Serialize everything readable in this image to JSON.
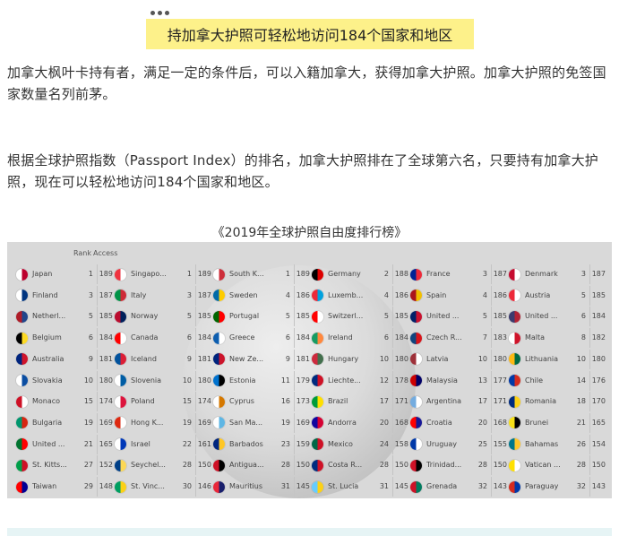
{
  "header": {
    "title": "持加拿大护照可轻松地访问184个国家和地区"
  },
  "paragraphs": [
    "加拿大枫叶卡持有者，满足一定的条件后，可以入籍加拿大，获得加拿大护照。加拿大护照的免签国家数量名列前茅。",
    "根据全球护照指数（Passport Index）的排名，加拿大护照排在了全球第六名，只要持有加拿大护照，现在可以轻松地访问184个国家和地区。"
  ],
  "caption": "《2019年全球护照自由度排行榜》",
  "table": {
    "rank_header": "Rank",
    "access_header": "Access",
    "columns": [
      [
        {
          "name": "Japan",
          "rank": "1",
          "access": "189",
          "colors": [
            "#ffffff",
            "#bc002d"
          ]
        },
        {
          "name": "Finland",
          "rank": "3",
          "access": "187",
          "colors": [
            "#ffffff",
            "#003580"
          ]
        },
        {
          "name": "Netherl...",
          "rank": "5",
          "access": "185",
          "colors": [
            "#ae1c28",
            "#21468b"
          ]
        },
        {
          "name": "Belgium",
          "rank": "6",
          "access": "184",
          "colors": [
            "#000000",
            "#fdda24"
          ]
        },
        {
          "name": "Australia",
          "rank": "9",
          "access": "181",
          "colors": [
            "#00247d",
            "#cf142b"
          ]
        },
        {
          "name": "Slovakia",
          "rank": "10",
          "access": "180",
          "colors": [
            "#ffffff",
            "#0b4ea2"
          ]
        },
        {
          "name": "Monaco",
          "rank": "15",
          "access": "174",
          "colors": [
            "#ce1126",
            "#ffffff"
          ]
        },
        {
          "name": "Bulgaria",
          "rank": "19",
          "access": "169",
          "colors": [
            "#00966e",
            "#d62612"
          ]
        },
        {
          "name": "United ...",
          "rank": "21",
          "access": "165",
          "colors": [
            "#00732f",
            "#ff0000"
          ]
        },
        {
          "name": "St. Kitts...",
          "rank": "27",
          "access": "152",
          "colors": [
            "#009e49",
            "#ce1126"
          ]
        },
        {
          "name": "Taiwan",
          "rank": "29",
          "access": "148",
          "colors": [
            "#fe0000",
            "#000095"
          ]
        }
      ],
      [
        {
          "name": "Singapo...",
          "rank": "1",
          "access": "189",
          "colors": [
            "#ef3340",
            "#ffffff"
          ]
        },
        {
          "name": "Italy",
          "rank": "3",
          "access": "187",
          "colors": [
            "#009246",
            "#ce2b37"
          ]
        },
        {
          "name": "Norway",
          "rank": "5",
          "access": "185",
          "colors": [
            "#ba0c2f",
            "#00205b"
          ]
        },
        {
          "name": "Canada",
          "rank": "6",
          "access": "184",
          "colors": [
            "#ff0000",
            "#ffffff"
          ]
        },
        {
          "name": "Iceland",
          "rank": "9",
          "access": "181",
          "colors": [
            "#02529c",
            "#dc1e35"
          ]
        },
        {
          "name": "Slovenia",
          "rank": "10",
          "access": "180",
          "colors": [
            "#ffffff",
            "#005da4"
          ]
        },
        {
          "name": "Poland",
          "rank": "15",
          "access": "174",
          "colors": [
            "#ffffff",
            "#dc143c"
          ]
        },
        {
          "name": "Hong K...",
          "rank": "19",
          "access": "169",
          "colors": [
            "#de2910",
            "#ffffff"
          ]
        },
        {
          "name": "Israel",
          "rank": "22",
          "access": "161",
          "colors": [
            "#ffffff",
            "#0038b8"
          ]
        },
        {
          "name": "Seychel...",
          "rank": "28",
          "access": "150",
          "colors": [
            "#003f87",
            "#fcd856"
          ]
        },
        {
          "name": "St. Vinc...",
          "rank": "30",
          "access": "146",
          "colors": [
            "#009e60",
            "#fcd116"
          ]
        }
      ],
      [
        {
          "name": "South K...",
          "rank": "1",
          "access": "189",
          "colors": [
            "#ffffff",
            "#cd2e3a"
          ]
        },
        {
          "name": "Sweden",
          "rank": "4",
          "access": "186",
          "colors": [
            "#006aa7",
            "#fecc00"
          ]
        },
        {
          "name": "Portugal",
          "rank": "5",
          "access": "185",
          "colors": [
            "#006600",
            "#ff0000"
          ]
        },
        {
          "name": "Greece",
          "rank": "6",
          "access": "184",
          "colors": [
            "#0d5eaf",
            "#ffffff"
          ]
        },
        {
          "name": "New Ze...",
          "rank": "9",
          "access": "181",
          "colors": [
            "#00247d",
            "#cc142b"
          ]
        },
        {
          "name": "Estonia",
          "rank": "11",
          "access": "179",
          "colors": [
            "#0072ce",
            "#000000"
          ]
        },
        {
          "name": "Cyprus",
          "rank": "16",
          "access": "173",
          "colors": [
            "#ffffff",
            "#d57800"
          ]
        },
        {
          "name": "San Ma...",
          "rank": "19",
          "access": "169",
          "colors": [
            "#ffffff",
            "#5eb6e4"
          ]
        },
        {
          "name": "Barbados",
          "rank": "23",
          "access": "159",
          "colors": [
            "#00267f",
            "#ffc726"
          ]
        },
        {
          "name": "Antigua...",
          "rank": "28",
          "access": "150",
          "colors": [
            "#ce1126",
            "#000000"
          ]
        },
        {
          "name": "Mauritius",
          "rank": "31",
          "access": "145",
          "colors": [
            "#ea2839",
            "#1a206d"
          ]
        }
      ],
      [
        {
          "name": "Germany",
          "rank": "2",
          "access": "188",
          "colors": [
            "#000000",
            "#dd0000"
          ]
        },
        {
          "name": "Luxemb...",
          "rank": "4",
          "access": "186",
          "colors": [
            "#ed2939",
            "#00a1de"
          ]
        },
        {
          "name": "Switzerl...",
          "rank": "5",
          "access": "185",
          "colors": [
            "#ff0000",
            "#ffffff"
          ]
        },
        {
          "name": "Ireland",
          "rank": "6",
          "access": "184",
          "colors": [
            "#169b62",
            "#ff883e"
          ]
        },
        {
          "name": "Hungary",
          "rank": "10",
          "access": "180",
          "colors": [
            "#cd2a3e",
            "#436f4d"
          ]
        },
        {
          "name": "Liechte...",
          "rank": "12",
          "access": "178",
          "colors": [
            "#002b7f",
            "#ce1126"
          ]
        },
        {
          "name": "Brazil",
          "rank": "17",
          "access": "171",
          "colors": [
            "#009c3b",
            "#ffdf00"
          ]
        },
        {
          "name": "Andorra",
          "rank": "20",
          "access": "168",
          "colors": [
            "#10069f",
            "#d50032"
          ]
        },
        {
          "name": "Mexico",
          "rank": "24",
          "access": "158",
          "colors": [
            "#006847",
            "#ce1126"
          ]
        },
        {
          "name": "Costa R...",
          "rank": "28",
          "access": "150",
          "colors": [
            "#002b7f",
            "#ce1126"
          ]
        },
        {
          "name": "St. Lucia",
          "rank": "31",
          "access": "145",
          "colors": [
            "#66ccff",
            "#fcd116"
          ]
        }
      ],
      [
        {
          "name": "France",
          "rank": "3",
          "access": "187",
          "colors": [
            "#002395",
            "#ed2939"
          ]
        },
        {
          "name": "Spain",
          "rank": "4",
          "access": "186",
          "colors": [
            "#aa151b",
            "#f1bf00"
          ]
        },
        {
          "name": "United ...",
          "rank": "5",
          "access": "185",
          "colors": [
            "#012169",
            "#c8102e"
          ]
        },
        {
          "name": "Czech R...",
          "rank": "7",
          "access": "183",
          "colors": [
            "#11457e",
            "#d7141a"
          ]
        },
        {
          "name": "Latvia",
          "rank": "10",
          "access": "180",
          "colors": [
            "#9e3039",
            "#ffffff"
          ]
        },
        {
          "name": "Malaysia",
          "rank": "13",
          "access": "177",
          "colors": [
            "#cc0001",
            "#010066"
          ]
        },
        {
          "name": "Argentina",
          "rank": "17",
          "access": "171",
          "colors": [
            "#74acdf",
            "#ffffff"
          ]
        },
        {
          "name": "Croatia",
          "rank": "20",
          "access": "168",
          "colors": [
            "#ff0000",
            "#171796"
          ]
        },
        {
          "name": "Uruguay",
          "rank": "25",
          "access": "155",
          "colors": [
            "#0038a8",
            "#ffffff"
          ]
        },
        {
          "name": "Trinidad...",
          "rank": "28",
          "access": "150",
          "colors": [
            "#ce1126",
            "#000000"
          ]
        },
        {
          "name": "Grenada",
          "rank": "32",
          "access": "143",
          "colors": [
            "#ce1126",
            "#007a5e"
          ]
        }
      ],
      [
        {
          "name": "Denmark",
          "rank": "3",
          "access": "187",
          "colors": [
            "#c60c30",
            "#ffffff"
          ]
        },
        {
          "name": "Austria",
          "rank": "5",
          "access": "185",
          "colors": [
            "#ed2939",
            "#ffffff"
          ]
        },
        {
          "name": "United ...",
          "rank": "6",
          "access": "184",
          "colors": [
            "#3c3b6e",
            "#b22234"
          ]
        },
        {
          "name": "Malta",
          "rank": "8",
          "access": "182",
          "colors": [
            "#ffffff",
            "#cf142b"
          ]
        },
        {
          "name": "Lithuania",
          "rank": "10",
          "access": "180",
          "colors": [
            "#fdb913",
            "#006a44"
          ]
        },
        {
          "name": "Chile",
          "rank": "14",
          "access": "176",
          "colors": [
            "#0039a6",
            "#d52b1e"
          ]
        },
        {
          "name": "Romania",
          "rank": "18",
          "access": "170",
          "colors": [
            "#002b7f",
            "#fcd116"
          ]
        },
        {
          "name": "Brunei",
          "rank": "21",
          "access": "165",
          "colors": [
            "#f7e017",
            "#000000"
          ]
        },
        {
          "name": "Bahamas",
          "rank": "26",
          "access": "154",
          "colors": [
            "#00778b",
            "#ffc72c"
          ]
        },
        {
          "name": "Vatican ...",
          "rank": "28",
          "access": "150",
          "colors": [
            "#ffe000",
            "#ffffff"
          ]
        },
        {
          "name": "Paraguay",
          "rank": "32",
          "access": "143",
          "colors": [
            "#d52b1e",
            "#0038a8"
          ]
        }
      ]
    ]
  },
  "accent": {
    "title_bg": "#fdf18a",
    "table_bg": "#d9d9d9"
  }
}
